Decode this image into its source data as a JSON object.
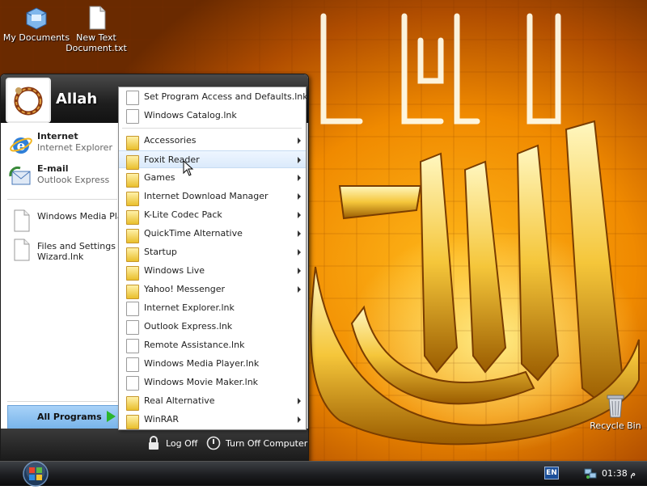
{
  "desktop": {
    "icons": [
      {
        "label": "My Documents",
        "icon": "my-documents-icon"
      },
      {
        "label": "New Text Document.txt",
        "icon": "text-file-icon"
      },
      {
        "label": "Recycle Bin",
        "icon": "recycle-bin-icon"
      }
    ],
    "wallpaper_colors": {
      "light": "#ffe58a",
      "mid": "#f08a00",
      "dark": "#6a2a00"
    }
  },
  "start_menu": {
    "username": "Allah",
    "pinned": [
      {
        "title": "Internet",
        "subtitle": "Internet Explorer",
        "icon": "internet-explorer-icon"
      },
      {
        "title": "E-mail",
        "subtitle": "Outlook Express",
        "icon": "outlook-express-icon"
      }
    ],
    "recent": [
      {
        "label": "Windows Media Playe",
        "icon": "document-icon"
      },
      {
        "label_line1": "Files and Settings Tra",
        "label_line2": "Wizard.lnk",
        "icon": "document-icon"
      }
    ],
    "all_programs_label": "All Programs",
    "log_off_label": "Log Off",
    "turn_off_label": "Turn Off Computer",
    "colors": {
      "header": "#1e1e1e",
      "all_programs_highlight": "#8cc2f2",
      "arrow": "#2bb52b"
    }
  },
  "programs_menu": {
    "items": [
      {
        "label": "Set Program Access and Defaults.lnk",
        "type": "file",
        "submenu": false
      },
      {
        "label": "Windows Catalog.lnk",
        "type": "file",
        "submenu": false
      },
      {
        "label": "Accessories",
        "type": "folder",
        "submenu": true
      },
      {
        "label": "Foxit Reader",
        "type": "folder",
        "submenu": true,
        "highlighted": true
      },
      {
        "label": "Games",
        "type": "folder",
        "submenu": true
      },
      {
        "label": "Internet Download Manager",
        "type": "folder",
        "submenu": true
      },
      {
        "label": "K-Lite Codec Pack",
        "type": "folder",
        "submenu": true
      },
      {
        "label": "QuickTime Alternative",
        "type": "folder",
        "submenu": true
      },
      {
        "label": "Startup",
        "type": "folder",
        "submenu": true
      },
      {
        "label": "Windows Live",
        "type": "folder",
        "submenu": true
      },
      {
        "label": "Yahoo! Messenger",
        "type": "folder",
        "submenu": true
      },
      {
        "label": "Internet Explorer.lnk",
        "type": "file",
        "submenu": false
      },
      {
        "label": "Outlook Express.lnk",
        "type": "file",
        "submenu": false
      },
      {
        "label": "Remote Assistance.lnk",
        "type": "file",
        "submenu": false
      },
      {
        "label": "Windows Media Player.lnk",
        "type": "file",
        "submenu": false
      },
      {
        "label": "Windows Movie Maker.lnk",
        "type": "file",
        "submenu": false
      },
      {
        "label": "Real Alternative",
        "type": "folder",
        "submenu": true
      },
      {
        "label": "WinRAR",
        "type": "folder",
        "submenu": true
      }
    ]
  },
  "taskbar": {
    "language": "EN",
    "clock": "01:38 م",
    "start_icon": "windows-start-orb-icon",
    "tray_icon": "network-icon"
  }
}
